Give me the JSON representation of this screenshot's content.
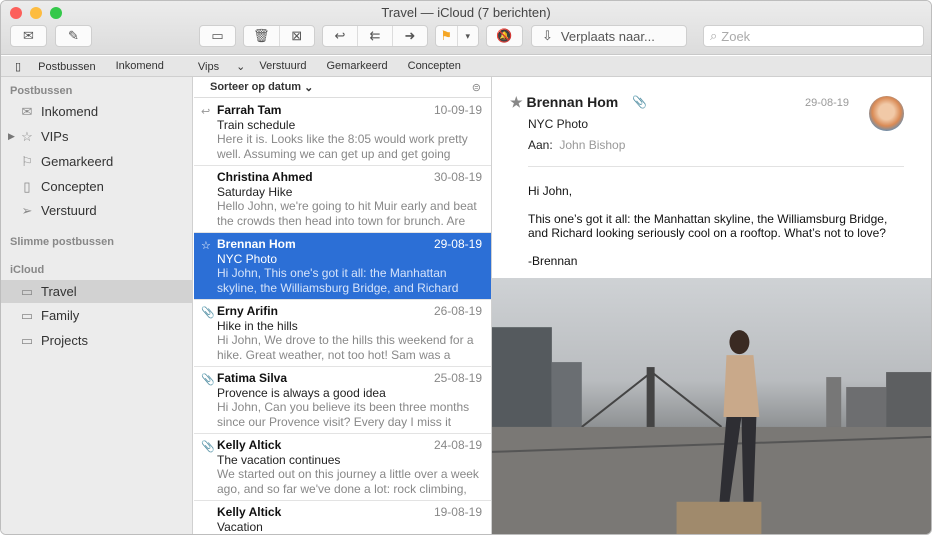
{
  "window": {
    "title": "Travel — iCloud (7 berichten)"
  },
  "toolbar": {
    "move_label": "Verplaats naar...",
    "search_placeholder": "Zoek",
    "flag_color": "#f5a623"
  },
  "favorites": {
    "mailboxes": "Postbussen",
    "items": [
      "Inkomend",
      "Vips",
      "Verstuurd",
      "Gemarkeerd",
      "Concepten"
    ]
  },
  "sidebar": {
    "header_mailboxes": "Postbussen",
    "mailboxes": [
      {
        "label": "Inkomend",
        "icon": "inbox-icon"
      },
      {
        "label": "VIPs",
        "icon": "star-icon"
      },
      {
        "label": "Gemarkeerd",
        "icon": "flag-icon"
      },
      {
        "label": "Concepten",
        "icon": "document-icon"
      },
      {
        "label": "Verstuurd",
        "icon": "paper-plane-icon"
      }
    ],
    "header_smart": "Slimme postbussen",
    "header_icloud": "iCloud",
    "icloud": [
      {
        "label": "Travel",
        "selected": true
      },
      {
        "label": "Family"
      },
      {
        "label": "Projects"
      }
    ]
  },
  "list": {
    "sort_label": "Sorteer op datum",
    "messages": [
      {
        "from": "Farrah Tam",
        "date": "10-09-19",
        "subject": "Train schedule",
        "preview": "Here it is. Looks like the 8:05 would work pretty well. Assuming we can get up and get going that...",
        "mark": "↩"
      },
      {
        "from": "Christina Ahmed",
        "date": "30-08-19",
        "subject": "Saturday Hike",
        "preview": "Hello John, we're going to hit Muir early and beat the crowds then head into town for brunch. Are y...",
        "mark": ""
      },
      {
        "from": "Brennan Hom",
        "date": "29-08-19",
        "subject": "NYC Photo",
        "preview": "Hi John, This one's got it all: the Manhattan skyline, the Williamsburg Bridge, and Richard loo...",
        "mark": "☆",
        "selected": true
      },
      {
        "from": "Erny Arifin",
        "date": "26-08-19",
        "subject": "Hike in the hills",
        "preview": "Hi John, We drove to the hills this weekend for a hike. Great weather, not too hot! Sam was a good...",
        "mark": "📎"
      },
      {
        "from": "Fatima Silva",
        "date": "25-08-19",
        "subject": "Provence is always a good idea",
        "preview": "Hi John, Can you believe its been three months since our Provence visit? Every day I miss it more...",
        "mark": "📎"
      },
      {
        "from": "Kelly Altick",
        "date": "24-08-19",
        "subject": "The vacation continues",
        "preview": "We started out on this journey a little over a week ago, and so far we've done a lot: rock climbing, c...",
        "mark": "📎"
      },
      {
        "from": "Kelly Altick",
        "date": "19-08-19",
        "subject": "Vacation",
        "preview": "",
        "mark": ""
      }
    ]
  },
  "detail": {
    "from": "Brennan Hom",
    "date": "29-08-19",
    "subject": "NYC Photo",
    "to_label": "Aan:",
    "to": "John Bishop",
    "body": [
      "Hi John,",
      "This one’s got it all: the Manhattan skyline, the Williamsburg Bridge, and Richard looking seriously cool on a rooftop. What’s not to love?",
      "-Brennan"
    ]
  }
}
